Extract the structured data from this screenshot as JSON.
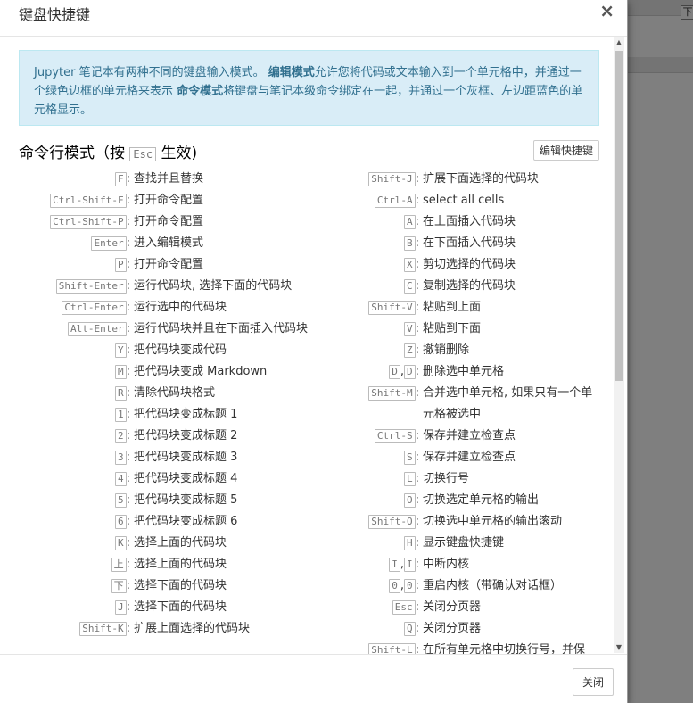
{
  "dialog": {
    "title": "键盘快捷键",
    "close_glyph": "×",
    "close_button": "关闭"
  },
  "background": {
    "tag_char": "下"
  },
  "info": {
    "part1": "Jupyter 笔记本有两种不同的键盘输入模式。 ",
    "edit_mode": "编辑模式",
    "part2": "允许您将代码或文本输入到一个单元格中，并通过一个绿色边框的单元格来表示 ",
    "command_mode": "命令模式",
    "part3": "将键盘与笔记本级命令绑定在一起，并通过一个灰框、左边距蓝色的单元格显示。"
  },
  "section": {
    "title_prefix": "命令行模式（按 ",
    "esc": "Esc",
    "title_suffix": " 生效)",
    "edit_shortcuts_label": "编辑快捷键"
  },
  "shortcuts_left": [
    {
      "keys": [
        "F"
      ],
      "desc": "查找并且替换"
    },
    {
      "keys": [
        "Ctrl-Shift-F"
      ],
      "desc": "打开命令配置"
    },
    {
      "keys": [
        "Ctrl-Shift-P"
      ],
      "desc": "打开命令配置"
    },
    {
      "keys": [
        "Enter"
      ],
      "desc": "进入编辑模式"
    },
    {
      "keys": [
        "P"
      ],
      "desc": "打开命令配置"
    },
    {
      "keys": [
        "Shift-Enter"
      ],
      "desc": "运行代码块, 选择下面的代码块"
    },
    {
      "keys": [
        "Ctrl-Enter"
      ],
      "desc": "运行选中的代码块"
    },
    {
      "keys": [
        "Alt-Enter"
      ],
      "desc": "运行代码块并且在下面插入代码块"
    },
    {
      "keys": [
        "Y"
      ],
      "desc": "把代码块变成代码"
    },
    {
      "keys": [
        "M"
      ],
      "desc": "把代码块变成 Markdown"
    },
    {
      "keys": [
        "R"
      ],
      "desc": "清除代码块格式"
    },
    {
      "keys": [
        "1"
      ],
      "desc": "把代码块变成标题 1"
    },
    {
      "keys": [
        "2"
      ],
      "desc": "把代码块变成标题 2"
    },
    {
      "keys": [
        "3"
      ],
      "desc": "把代码块变成标题 3"
    },
    {
      "keys": [
        "4"
      ],
      "desc": "把代码块变成标题 4"
    },
    {
      "keys": [
        "5"
      ],
      "desc": "把代码块变成标题 5"
    },
    {
      "keys": [
        "6"
      ],
      "desc": "把代码块变成标题 6"
    },
    {
      "keys": [
        "K"
      ],
      "desc": "选择上面的代码块"
    },
    {
      "keys": [
        "上"
      ],
      "desc": "选择上面的代码块"
    },
    {
      "keys": [
        "下"
      ],
      "desc": "选择下面的代码块"
    },
    {
      "keys": [
        "J"
      ],
      "desc": "选择下面的代码块"
    },
    {
      "keys": [
        "Shift-K"
      ],
      "desc": "扩展上面选择的代码块"
    }
  ],
  "shortcuts_right": [
    {
      "keys": [
        "Shift-J"
      ],
      "desc": "扩展下面选择的代码块"
    },
    {
      "keys": [
        "Ctrl-A"
      ],
      "desc": "select all cells"
    },
    {
      "keys": [
        "A"
      ],
      "desc": "在上面插入代码块"
    },
    {
      "keys": [
        "B"
      ],
      "desc": "在下面插入代码块"
    },
    {
      "keys": [
        "X"
      ],
      "desc": "剪切选择的代码块"
    },
    {
      "keys": [
        "C"
      ],
      "desc": "复制选择的代码块"
    },
    {
      "keys": [
        "Shift-V"
      ],
      "desc": "粘贴到上面"
    },
    {
      "keys": [
        "V"
      ],
      "desc": "粘贴到下面"
    },
    {
      "keys": [
        "Z"
      ],
      "desc": "撤销删除"
    },
    {
      "keys": [
        "D",
        "D"
      ],
      "desc": "删除选中单元格"
    },
    {
      "keys": [
        "Shift-M"
      ],
      "desc": "合并选中单元格, 如果只有一个单元格被选中"
    },
    {
      "keys": [
        "Ctrl-S"
      ],
      "desc": "保存并建立检查点"
    },
    {
      "keys": [
        "S"
      ],
      "desc": "保存并建立检查点"
    },
    {
      "keys": [
        "L"
      ],
      "desc": "切换行号"
    },
    {
      "keys": [
        "O"
      ],
      "desc": "切换选定单元格的输出"
    },
    {
      "keys": [
        "Shift-O"
      ],
      "desc": "切换选中单元格的输出滚动"
    },
    {
      "keys": [
        "H"
      ],
      "desc": "显示键盘快捷键"
    },
    {
      "keys": [
        "I",
        "I"
      ],
      "desc": "中断内核"
    },
    {
      "keys": [
        "0",
        "0"
      ],
      "desc": "重启内核（带确认对话框）"
    },
    {
      "keys": [
        "Esc"
      ],
      "desc": "关闭分页器"
    },
    {
      "keys": [
        "Q"
      ],
      "desc": "关闭分页器"
    },
    {
      "keys": [
        "Shift-L"
      ],
      "desc": "在所有单元格中切换行号，并保"
    }
  ]
}
